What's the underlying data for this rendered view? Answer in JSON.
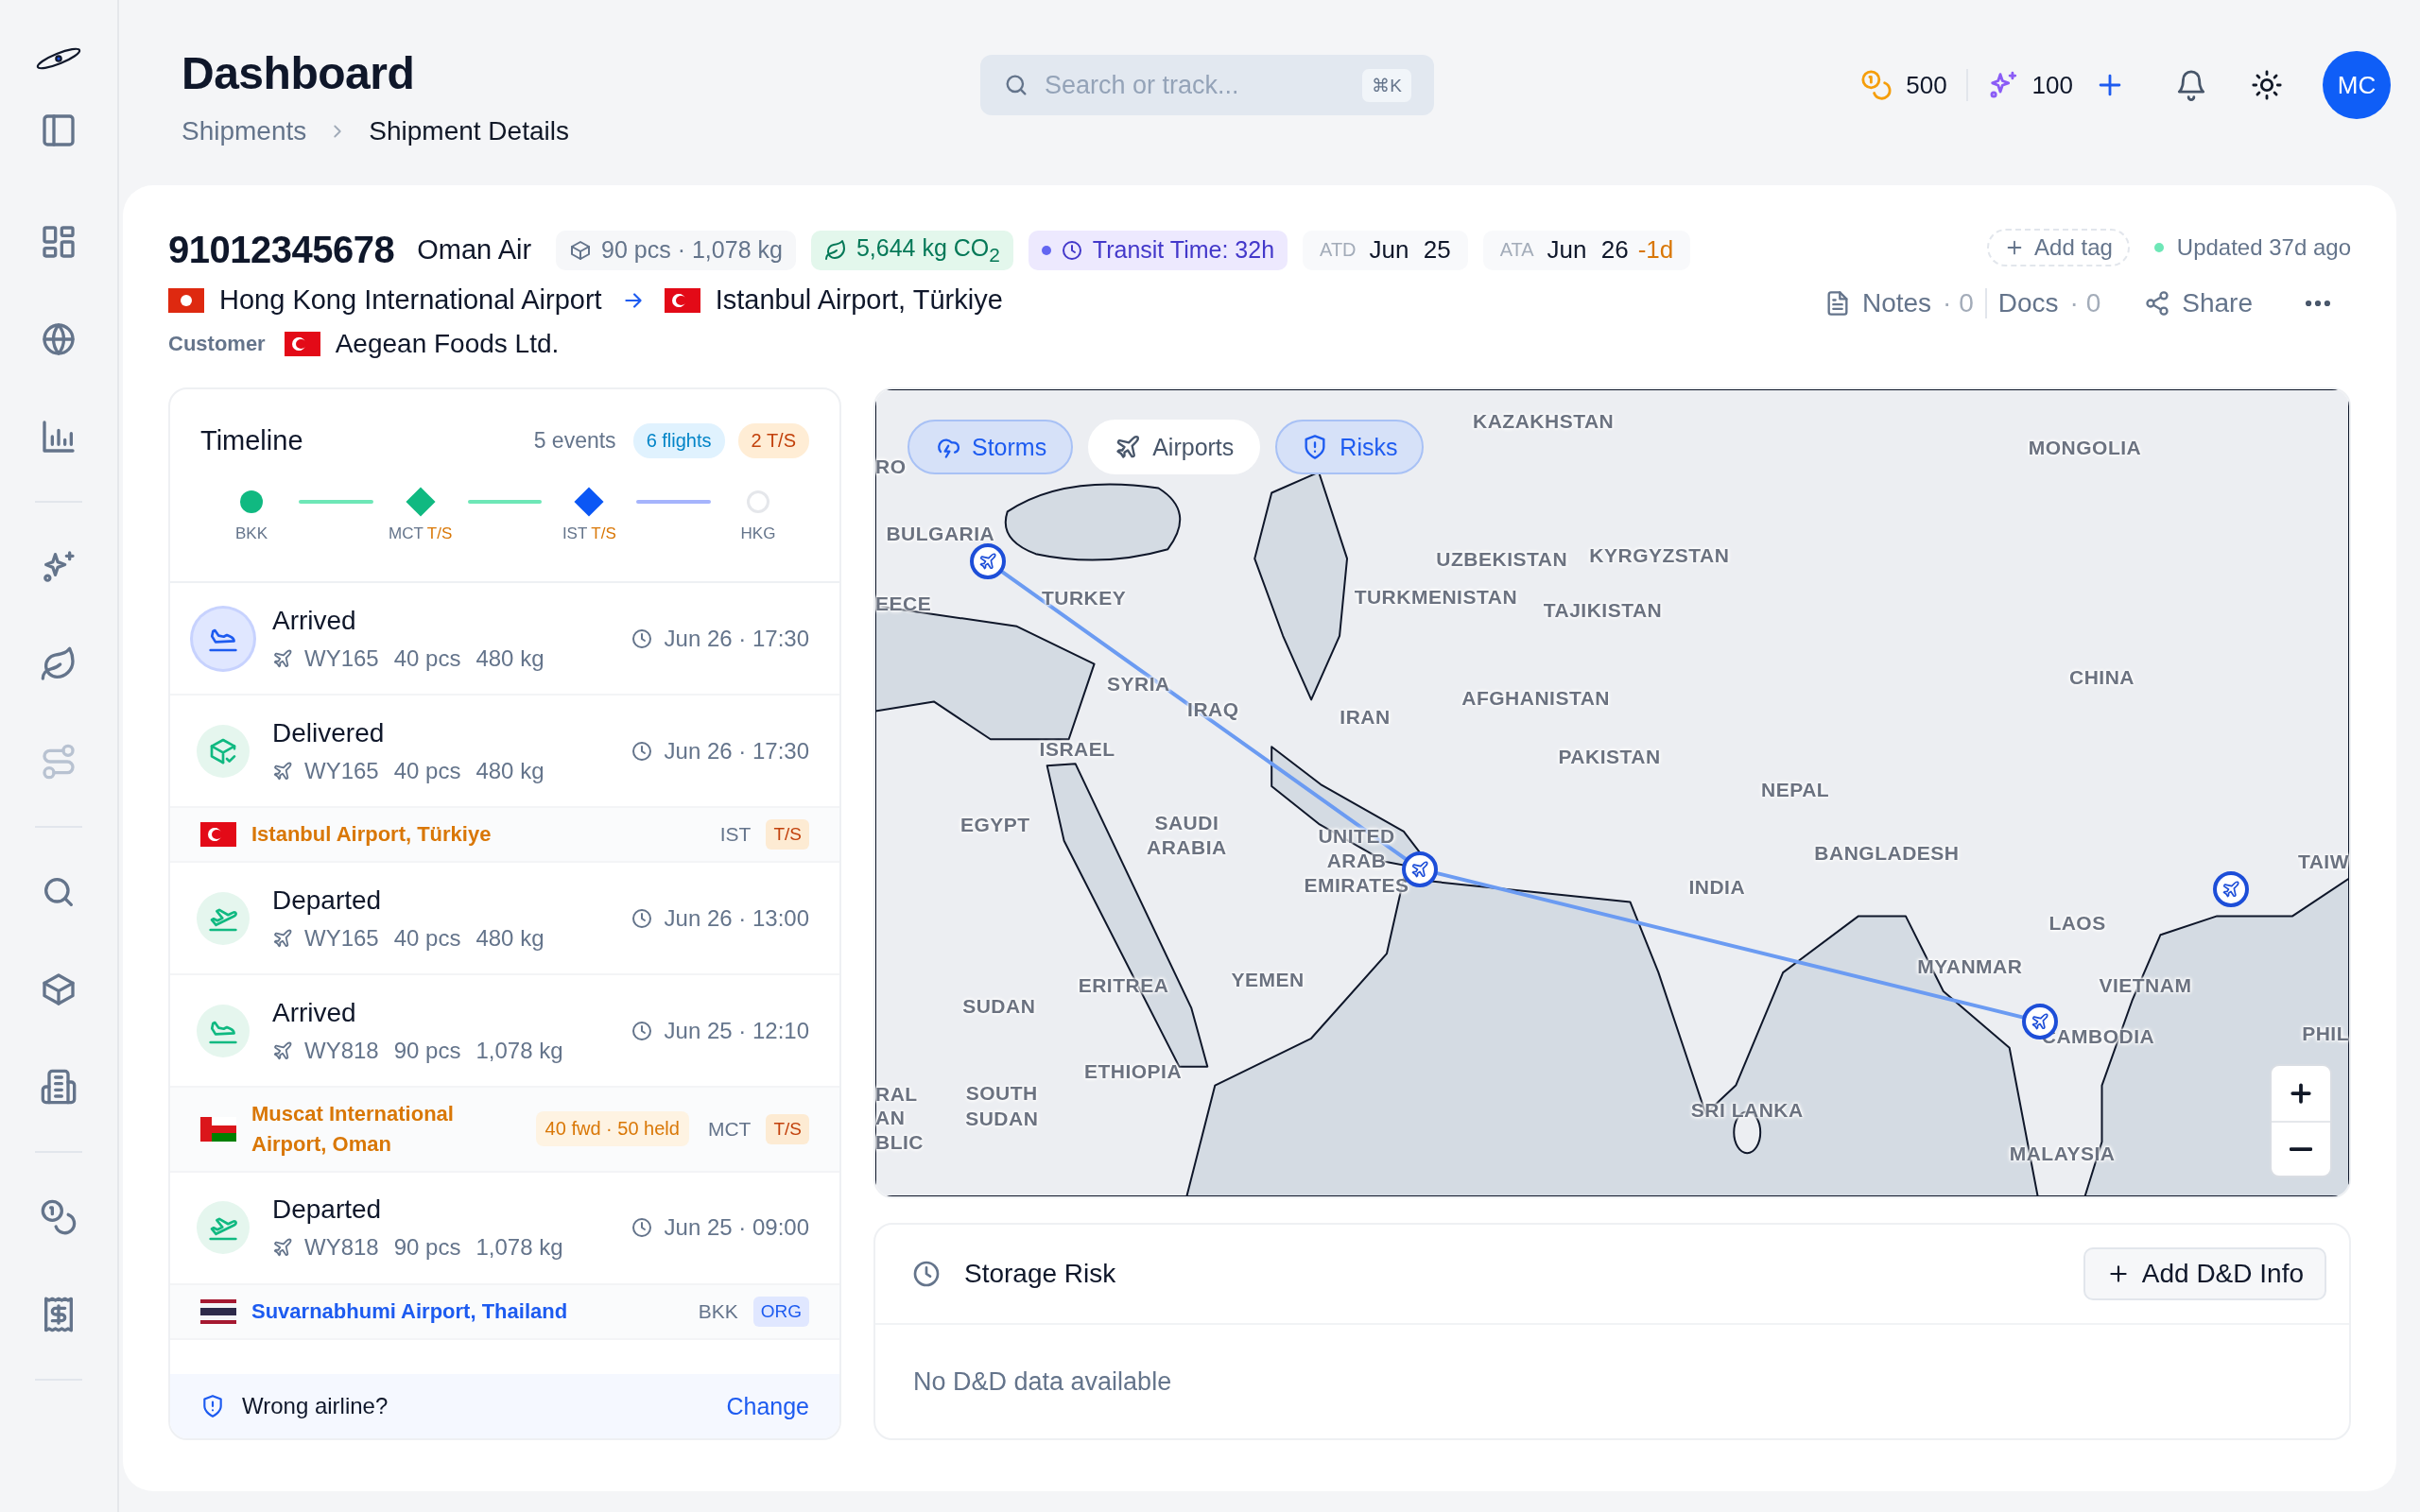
{
  "sidebar": {
    "groups": [
      [
        {
          "disabled": false
        },
        {
          "disabled": false
        },
        {
          "disabled": false
        }
      ],
      [
        {
          "disabled": false
        },
        {
          "disabled": false
        },
        {
          "disabled": true
        }
      ],
      [
        {
          "disabled": false
        },
        {
          "disabled": false
        },
        {
          "disabled": false
        }
      ],
      [
        {
          "disabled": false
        },
        {
          "disabled": false
        }
      ]
    ]
  },
  "header": {
    "title": "Dashboard",
    "breadcrumb": [
      {
        "label": "Shipments"
      },
      {
        "label": "Shipment Details"
      }
    ],
    "search": {
      "placeholder": "Search or track...",
      "shortcut": "⌘K"
    },
    "credits": "500",
    "ai_credits": "100",
    "avatar": "MC"
  },
  "shipment": {
    "number": "91012345678",
    "airline": "Oman Air",
    "pieces": "90 pcs · 1,078 kg",
    "co2": "5,644 kg CO$_{2}$",
    "transit": "Transit Time: 32h",
    "atd": {
      "label": "ATD",
      "date": "Jun 25"
    },
    "ata": {
      "label": "ATA",
      "date": "Jun 26",
      "delay": "-1d"
    },
    "origin": {
      "flag": {
        "kind": "hk"
      },
      "name": "Hong Kong International Airport"
    },
    "destination": {
      "flag": {
        "kind": "tr"
      },
      "name": "Istanbul Airport, Türkiye"
    },
    "customer": {
      "label": "Customer",
      "flag": {
        "kind": "tr"
      },
      "name": "Aegean Foods Ltd."
    },
    "add_tag": "Add tag",
    "updated": "Updated 37d ago",
    "notes": {
      "label": "Notes",
      "count": "· 0"
    },
    "docs": {
      "label": "Docs",
      "count": "· 0"
    },
    "share": "Share"
  },
  "timeline": {
    "title": "Timeline",
    "events_count": "5 events",
    "flights": "6 flights",
    "transshipments": "2 T/S",
    "stops": [
      {
        "code": "BKK",
        "kind": "airport",
        "completed": true,
        "current": false
      },
      {
        "code": "MCT",
        "tag": "T/S",
        "kind": "transit",
        "completed": true,
        "current": false
      },
      {
        "code": "IST",
        "tag": "T/S",
        "kind": "transit",
        "completed": false,
        "current": true
      },
      {
        "code": "HKG",
        "kind": "airport",
        "completed": false,
        "current": false
      }
    ],
    "items": [
      {
        "kind": "arrived",
        "selected": true,
        "title": "Arrived",
        "flight": "WY165",
        "pieces": "40 pcs",
        "weight": "480 kg",
        "time": "Jun 26 · 17:30"
      },
      {
        "kind": "delivered",
        "selected": false,
        "title": "Delivered",
        "flight": "WY165",
        "pieces": "40 pcs",
        "weight": "480 kg",
        "time": "Jun 26 · 17:30"
      },
      {
        "kind": "transit_stop",
        "flag": {
          "kind": "tr"
        },
        "name": "Istanbul Airport, Türkiye",
        "code": "IST",
        "tag": "T/S"
      },
      {
        "kind": "departed",
        "selected": false,
        "title": "Departed",
        "flight": "WY165",
        "pieces": "40 pcs",
        "weight": "480 kg",
        "time": "Jun 26 · 13:00"
      },
      {
        "kind": "arrived",
        "selected": false,
        "title": "Arrived",
        "flight": "WY818",
        "pieces": "90 pcs",
        "weight": "1,078 kg",
        "time": "Jun 25 · 12:10"
      },
      {
        "kind": "transit_stop",
        "flag": {
          "kind": "om"
        },
        "name": "Muscat International Airport, Oman",
        "note": "40 fwd · 50 held",
        "code": "MCT",
        "tag": "T/S"
      },
      {
        "kind": "departed",
        "selected": false,
        "title": "Departed",
        "flight": "WY818",
        "pieces": "90 pcs",
        "weight": "1,078 kg",
        "time": "Jun 25 · 09:00"
      },
      {
        "kind": "origin_stop",
        "flag": {
          "kind": "th"
        },
        "name": "Suvarnabhumi Airport, Thailand",
        "code": "BKK",
        "tag": "ORG"
      }
    ],
    "footer": {
      "text": "Wrong airline?",
      "link": "Change"
    }
  },
  "map": {
    "filters": [
      {
        "label": "Storms",
        "selected": true
      },
      {
        "label": "Airports",
        "selected": false
      },
      {
        "label": "Risks",
        "selected": true
      }
    ],
    "labels": [
      "KAZAKHSTAN",
      "MONGOLIA",
      "RO",
      "BULGARIA",
      "UZBEKISTAN",
      "KYRGYZSTAN",
      "EECE",
      "TURKEY",
      "TURKMENISTAN",
      "TAJIKISTAN",
      "CHINA",
      "SYRIA",
      "IRAQ",
      "AFGHANISTAN",
      "IRAN",
      "ISRAEL",
      "PAKISTAN",
      "NEPAL",
      "EGYPT",
      "SAUDI ARABIA",
      "UNITED ARAB EMIRATES",
      "BANGLADESH",
      "INDIA",
      "TAIW",
      "LAOS",
      "MYANMAR",
      "ERITREA",
      "YEMEN",
      "VIETNAM",
      "SUDAN",
      "CAMBODIA",
      "PHIL",
      "ETHIOPIA",
      "RAL",
      "AN",
      "BLIC",
      "SOUTH SUDAN",
      "SRI LANKA",
      "MALAYSIA"
    ]
  },
  "storage_risk": {
    "title": "Storage Risk",
    "button": "Add D&D Info",
    "empty": "No D&D data available"
  }
}
